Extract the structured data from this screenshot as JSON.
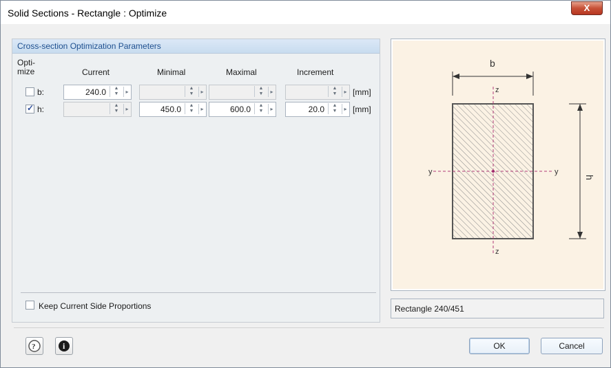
{
  "window": {
    "title": "Solid Sections - Rectangle : Optimize",
    "close": "X"
  },
  "panel": {
    "header": "Cross-section Optimization Parameters"
  },
  "columns": {
    "optimize_line1": "Opti-",
    "optimize_line2": "mize",
    "current": "Current",
    "minimal": "Minimal",
    "maximal": "Maximal",
    "increment": "Increment"
  },
  "rows": [
    {
      "label": "b:",
      "checked": false,
      "current": "240.0",
      "minimal": "",
      "maximal": "",
      "increment": "",
      "unit": "[mm]"
    },
    {
      "label": "h:",
      "checked": true,
      "current": "",
      "minimal": "450.0",
      "maximal": "600.0",
      "increment": "20.0",
      "unit": "[mm]"
    }
  ],
  "keep": {
    "label": "Keep Current Side Proportions"
  },
  "diagram": {
    "b": "b",
    "h": "h",
    "z_top": "z",
    "z_bottom": "z",
    "y_left": "y",
    "y_right": "y"
  },
  "description": "Rectangle 240/451",
  "buttons": {
    "ok": "OK",
    "cancel": "Cancel"
  }
}
